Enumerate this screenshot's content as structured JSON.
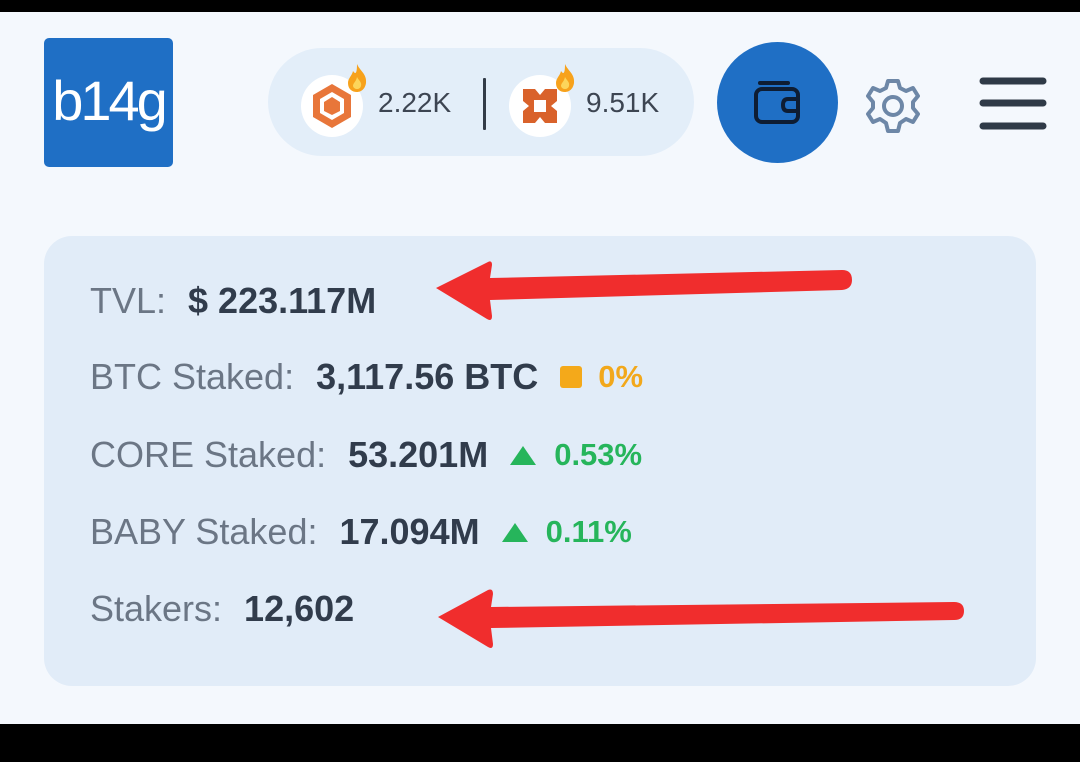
{
  "header": {
    "logo_text": "b14g",
    "stats": [
      {
        "icon": "core-coin-icon",
        "value": "2.22K"
      },
      {
        "icon": "babylon-coin-icon",
        "value": "9.51K"
      }
    ],
    "wallet_icon": "wallet-icon",
    "settings_icon": "gear-icon",
    "menu_icon": "hamburger-menu-icon"
  },
  "stats_card": {
    "tvl": {
      "label": "TVL:",
      "value": "$ 223.117M"
    },
    "btc": {
      "label": "BTC Staked:",
      "value": "3,117.56 BTC",
      "change": "0%",
      "trend": "neutral"
    },
    "core": {
      "label": "CORE Staked:",
      "value": "53.201M",
      "change": "0.53%",
      "trend": "up"
    },
    "baby": {
      "label": "BABY Staked:",
      "value": "17.094M",
      "change": "0.11%",
      "trend": "up"
    },
    "stakers": {
      "label": "Stakers:",
      "value": "12,602"
    }
  },
  "colors": {
    "brand": "#1f6fc5",
    "card_bg": "#e1ecf8",
    "up": "#26b55b",
    "neutral": "#f2a81b",
    "annotation_arrow": "#f02d2d"
  }
}
